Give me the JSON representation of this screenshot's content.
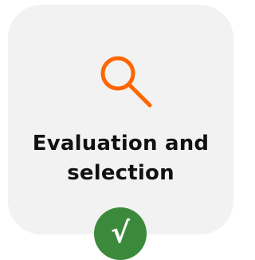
{
  "card": {
    "title_line1": "Evaluation and",
    "title_line2": "selection",
    "icon": "search-icon",
    "icon_color": "#ff6600"
  },
  "status": {
    "icon": "check-mark-icon",
    "symbol": "√",
    "color": "#3b8a3c"
  }
}
